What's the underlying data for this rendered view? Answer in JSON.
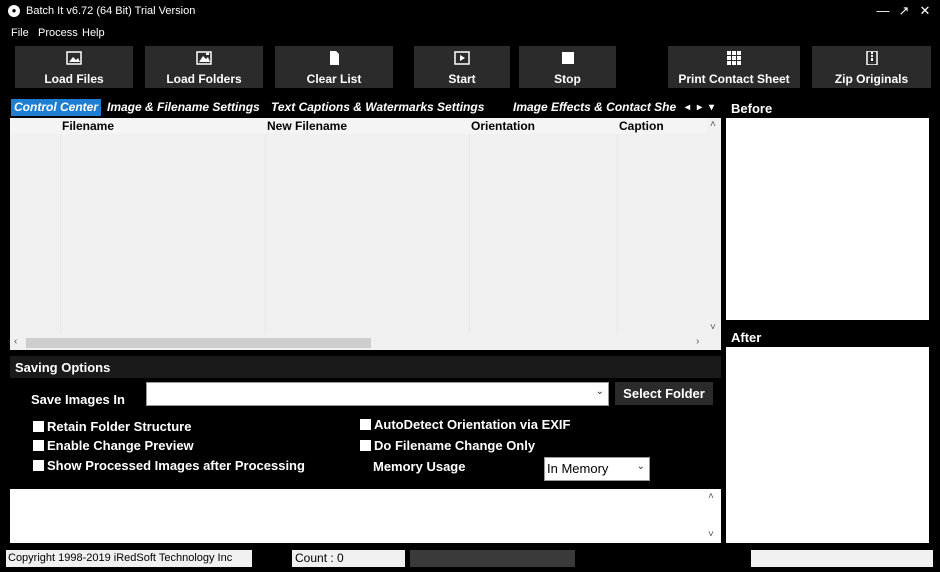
{
  "window": {
    "title": "Batch It v6.72 (64 Bit) Trial Version",
    "minimize": "—",
    "restore": "↗",
    "close": "✕"
  },
  "menu": [
    "File",
    "Process",
    "Help"
  ],
  "toolbar": {
    "load_files": "Load Files",
    "load_folders": "Load Folders",
    "clear_list": "Clear List",
    "start": "Start",
    "stop": "Stop",
    "print_contact_sheet": "Print Contact Sheet",
    "zip_originals": "Zip Originals"
  },
  "tabs": [
    {
      "label": "Control Center",
      "active": true
    },
    {
      "label": "Image & Filename Settings",
      "active": false
    },
    {
      "label": "Text Captions & Watermarks Settings",
      "active": false
    },
    {
      "label": "Image Effects & Contact She",
      "active": false
    }
  ],
  "tab_nav": {
    "left": "◂",
    "right": "▸",
    "menu": "▾"
  },
  "grid": {
    "columns": [
      "Filename",
      "New Filename",
      "Orientation",
      "Caption"
    ],
    "rows": []
  },
  "preview": {
    "before": "Before",
    "after": "After"
  },
  "saving": {
    "title": "Saving Options",
    "save_images_in_label": "Save Images In",
    "save_images_in_value": "",
    "select_folder": "Select Folder",
    "retain_folder_structure": "Retain Folder Structure",
    "enable_change_preview": "Enable Change Preview",
    "show_processed": "Show Processed Images after Processing",
    "autodetect_orientation": "AutoDetect Orientation via EXIF",
    "filename_change_only": "Do Filename Change Only",
    "memory_usage_label": "Memory Usage",
    "memory_usage_value": "In Memory"
  },
  "status": {
    "copyright": "Copyright 1998-2019 iRedSoft Technology Inc",
    "count": "Count : 0"
  },
  "colors": {
    "accent": "#1e7fd2",
    "background": "#000000",
    "button": "#2b2b2b"
  }
}
